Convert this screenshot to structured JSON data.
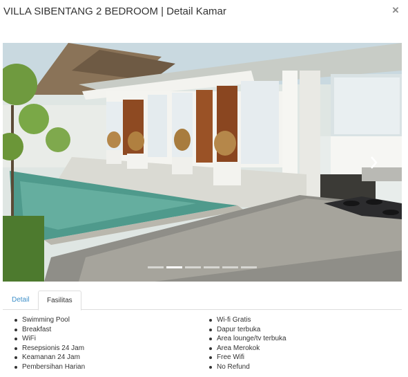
{
  "modal": {
    "title": "VILLA SIBENTANG 2 BEDROOM | Detail Kamar",
    "close_label": "×"
  },
  "carousel": {
    "next_icon": "chevron-right-icon",
    "slide_count": 6,
    "active_index": 1
  },
  "tabs": [
    {
      "label": "Detail",
      "active": false
    },
    {
      "label": "Fasilitas",
      "active": true
    }
  ],
  "facilities": {
    "left": [
      "Swimming Pool",
      "Breakfast",
      "WiFi",
      "Resepsionis 24 Jam",
      "Keamanan 24 Jam",
      "Pembersihan Harian"
    ],
    "right": [
      "Wi-fi Gratis",
      "Dapur terbuka",
      "Area lounge/tv terbuka",
      "Area Merokok",
      "Free Wifi",
      "No Refund"
    ]
  },
  "colors": {
    "tab_link": "#3d8fc9",
    "text": "#333333",
    "pool": "#4f9a8c"
  }
}
